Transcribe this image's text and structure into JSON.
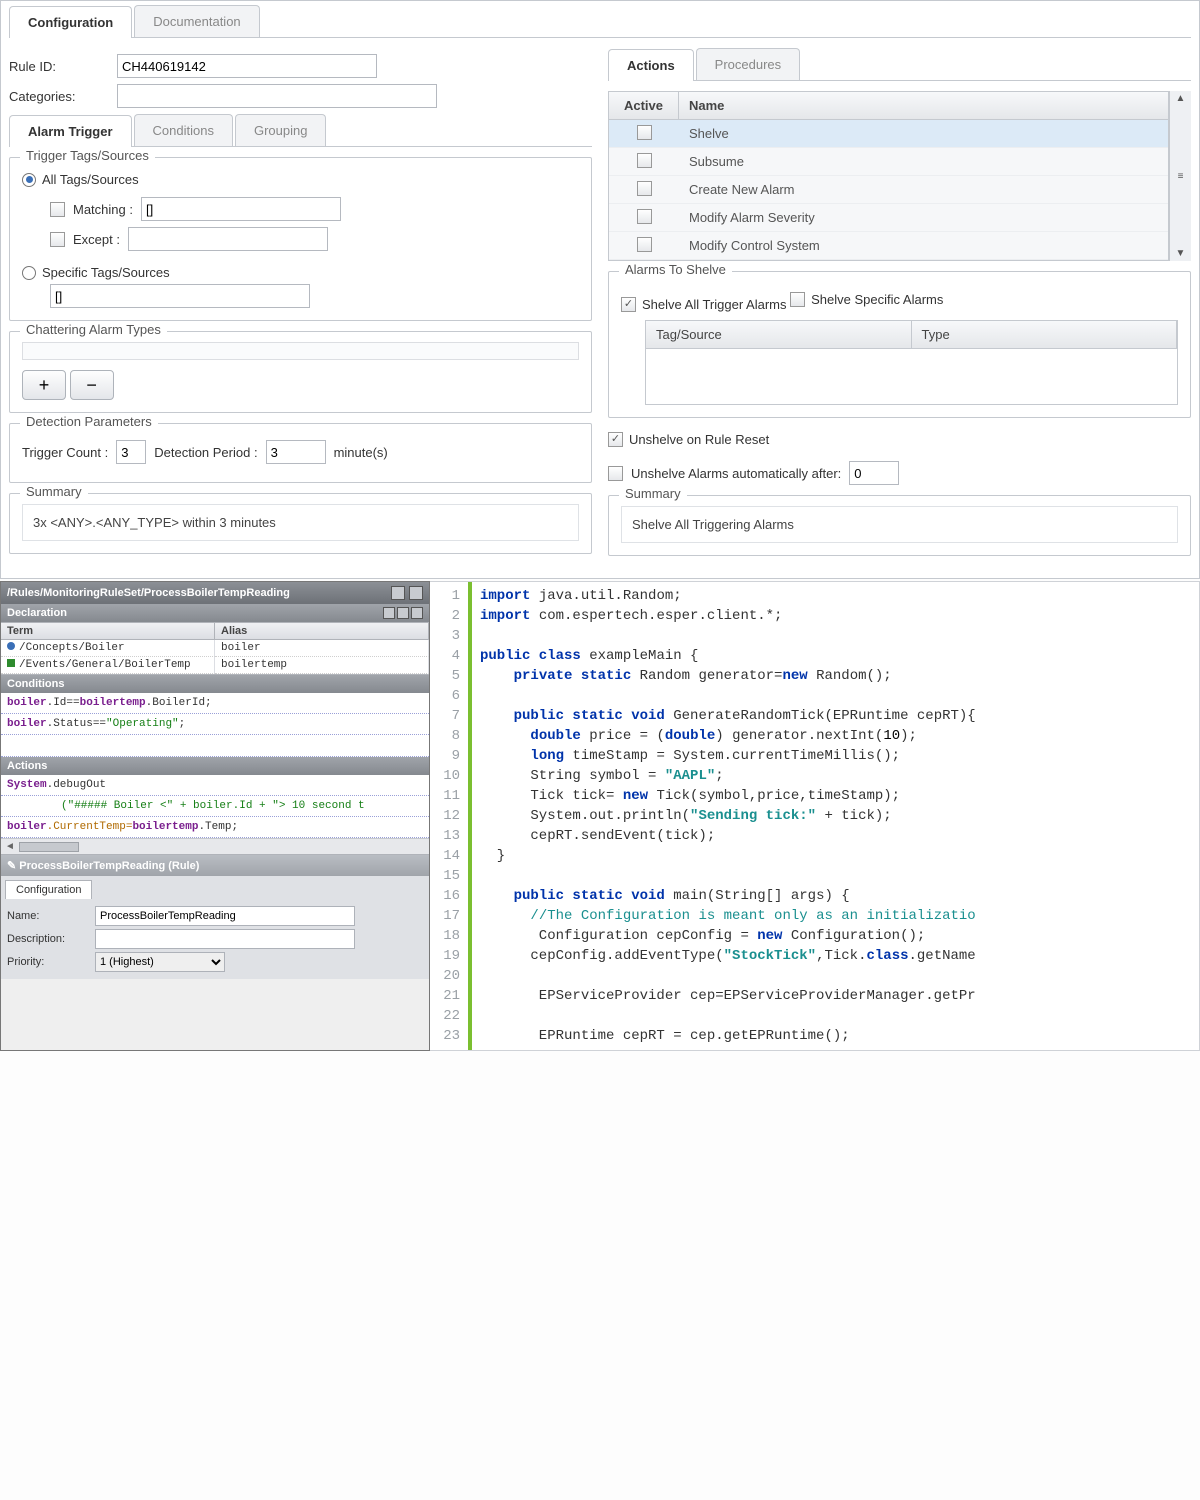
{
  "top_tabs": {
    "configuration": "Configuration",
    "documentation": "Documentation"
  },
  "rule_id_label": "Rule ID:",
  "rule_id_value": "CH440619142",
  "categories_label": "Categories:",
  "categories_value": "",
  "trigger_tabs": {
    "alarm_trigger": "Alarm Trigger",
    "conditions": "Conditions",
    "grouping": "Grouping"
  },
  "trigger_tags": {
    "legend": "Trigger Tags/Sources",
    "all_label": "All Tags/Sources",
    "matching_label": "Matching :",
    "matching_value": "[]",
    "except_label": "Except :",
    "specific_label": "Specific Tags/Sources",
    "specific_value": "[]"
  },
  "chattering": {
    "legend": "Chattering Alarm Types",
    "add": "+",
    "remove": "−"
  },
  "detection": {
    "legend": "Detection Parameters",
    "trigger_count_label": "Trigger Count :",
    "trigger_count_value": "3",
    "detection_period_label": "Detection Period :",
    "detection_period_value": "3",
    "unit": "minute(s)"
  },
  "left_summary": {
    "legend": "Summary",
    "text": "3x <ANY>.<ANY_TYPE> within 3 minutes"
  },
  "right_tabs": {
    "actions": "Actions",
    "procedures": "Procedures"
  },
  "actions_table": {
    "head_active": "Active",
    "head_name": "Name",
    "rows": [
      {
        "name": "Shelve"
      },
      {
        "name": "Subsume"
      },
      {
        "name": "Create New Alarm"
      },
      {
        "name": "Modify Alarm Severity"
      },
      {
        "name": "Modify Control System"
      }
    ]
  },
  "alarms_to_shelve": {
    "legend": "Alarms To Shelve",
    "shelve_all": "Shelve All Trigger Alarms",
    "shelve_specific": "Shelve Specific Alarms",
    "col_tag": "Tag/Source",
    "col_type": "Type"
  },
  "unshelve_reset": "Unshelve on Rule Reset",
  "unshelve_auto_label": "Unshelve Alarms automatically after:",
  "unshelve_auto_value": "0",
  "right_summary": {
    "legend": "Summary",
    "text": "Shelve All Triggering Alarms"
  },
  "ide": {
    "title": "/Rules/MonitoringRuleSet/ProcessBoilerTempReading",
    "declaration": "Declaration",
    "term": "Term",
    "alias": "Alias",
    "row1_term": "/Concepts/Boiler",
    "row1_alias": "boiler",
    "row2_term": "/Events/General/BoilerTemp",
    "row2_alias": "boilertemp",
    "conditions": "Conditions",
    "cond1_a": "boiler",
    "cond1_b": ".Id==",
    "cond1_c": "boilertemp",
    "cond1_d": ".BoilerId;",
    "cond2_a": "boiler",
    "cond2_b": ".Status==",
    "cond2_c": "\"Operating\"",
    "cond2_d": ";",
    "actions": "Actions",
    "act1_a": "System",
    "act1_b": ".debugOut",
    "act2": "(\"##### Boiler <\" + boiler.Id + \"> 10 second t",
    "act3_a": "boiler",
    "act3_b": ".CurrentTemp=",
    "act3_c": "boilertemp",
    "act3_d": ".Temp;",
    "footer_title": "ProcessBoilerTempReading (Rule)",
    "footer_tab": "Configuration",
    "name_label": "Name:",
    "name_value": "ProcessBoilerTempReading",
    "desc_label": "Description:",
    "priority_label": "Priority:",
    "priority_value": "1 (Highest)"
  },
  "code": {
    "l1": "import java.util.Random;",
    "l2": "import com.espertech.esper.client.*;",
    "l4": "public class exampleMain {",
    "l5": "    private static Random generator=new Random();",
    "l7": "    public static void GenerateRandomTick(EPRuntime cepRT){",
    "l8": "      double price = (double) generator.nextInt(10);",
    "l9": "      long timeStamp = System.currentTimeMillis();",
    "l10": "      String symbol = \"AAPL\";",
    "l11": "      Tick tick= new Tick(symbol,price,timeStamp);",
    "l12": "      System.out.println(\"Sending tick:\" + tick);",
    "l13": "      cepRT.sendEvent(tick);",
    "l14": "  }",
    "l16": "    public static void main(String[] args) {",
    "l17": "      //The Configuration is meant only as an initializatio",
    "l18": "       Configuration cepConfig = new Configuration();",
    "l19": "      cepConfig.addEventType(\"StockTick\",Tick.class.getName",
    "l21": "       EPServiceProvider cep=EPServiceProviderManager.getPr",
    "l23": "       EPRuntime cepRT = cep.getEPRuntime();"
  }
}
